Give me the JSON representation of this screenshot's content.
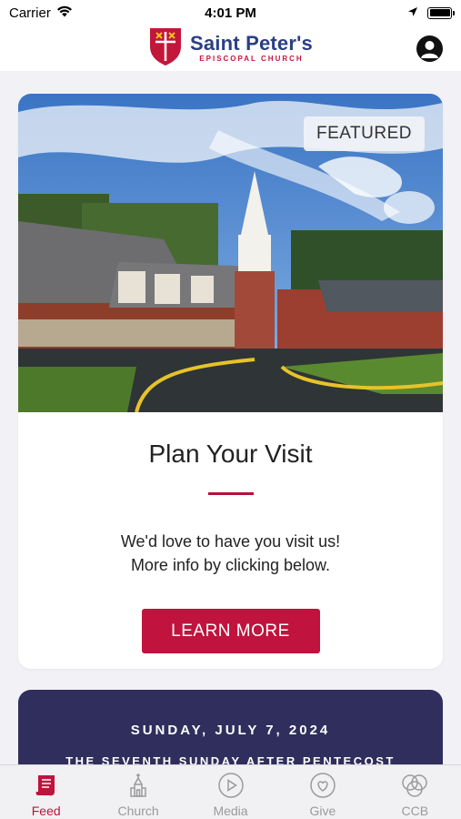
{
  "status": {
    "carrier": "Carrier",
    "time": "4:01 PM"
  },
  "header": {
    "title": "Saint Peter's",
    "subtitle": "EPISCOPAL CHURCH"
  },
  "featured": {
    "badge": "FEATURED",
    "title": "Plan Your Visit",
    "body_line1": "We'd love to have you visit us!",
    "body_line2": "More info by clicking below.",
    "button": "LEARN MORE"
  },
  "date_card": {
    "date": "SUNDAY, JULY 7, 2024",
    "occasion": "THE SEVENTH SUNDAY AFTER PENTECOST"
  },
  "tabs": [
    {
      "label": "Feed",
      "icon": "scroll-icon",
      "active": true
    },
    {
      "label": "Church",
      "icon": "church-icon",
      "active": false
    },
    {
      "label": "Media",
      "icon": "play-icon",
      "active": false
    },
    {
      "label": "Give",
      "icon": "heart-icon",
      "active": false
    },
    {
      "label": "CCB",
      "icon": "circles-icon",
      "active": false
    }
  ],
  "colors": {
    "brand_red": "#c0133d",
    "brand_blue": "#2a3f85",
    "date_card_bg": "#2f2e5c"
  }
}
